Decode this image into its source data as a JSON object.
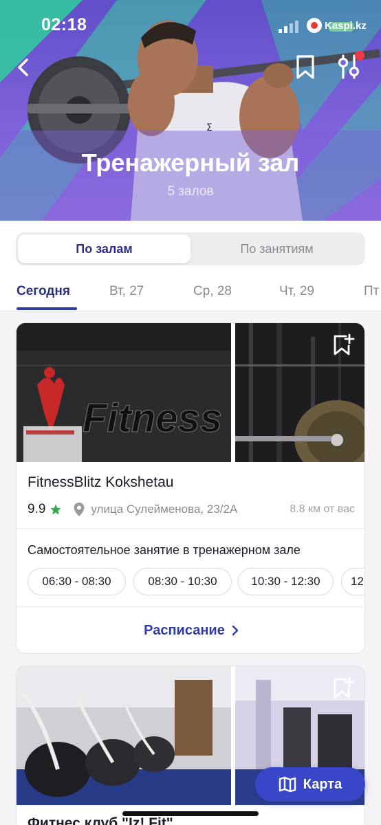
{
  "status_bar": {
    "time": "02:18",
    "carrier": "Kaspi.kz"
  },
  "header": {
    "title": "Тренажерный зал",
    "subtitle": "5 залов",
    "icons": [
      "back-arrow-icon",
      "bookmark-icon",
      "filter-sliders-icon"
    ]
  },
  "segment": {
    "options": [
      "По залам",
      "По занятиям"
    ],
    "selected": "По залам"
  },
  "date_tabs": {
    "items": [
      "Сегодня",
      "Вт, 27",
      "Ср, 28",
      "Чт, 29",
      "Пт"
    ],
    "selected": "Сегодня"
  },
  "gyms": [
    {
      "photo_text": "Fitness",
      "name": "FitnessBlitz Kokshetau",
      "rating": "9.9",
      "address": "улица Сулейменова, 23/2А",
      "distance": "8.8 км от вас",
      "session_title": "Самостоятельное занятие в тренажерном зале",
      "slots": [
        "06:30 - 08:30",
        "08:30 - 10:30",
        "10:30 - 12:30",
        "12:"
      ],
      "schedule_label": "Расписание"
    },
    {
      "name": "Фитнес клуб \"Iz! Fit\""
    }
  ],
  "map_button": {
    "label": "Карта"
  },
  "colors": {
    "accent": "#2f3aa8",
    "hero": "#7e61da",
    "star": "#2fae4e",
    "badge": "#ee3a48",
    "fab": "#3846c8"
  }
}
